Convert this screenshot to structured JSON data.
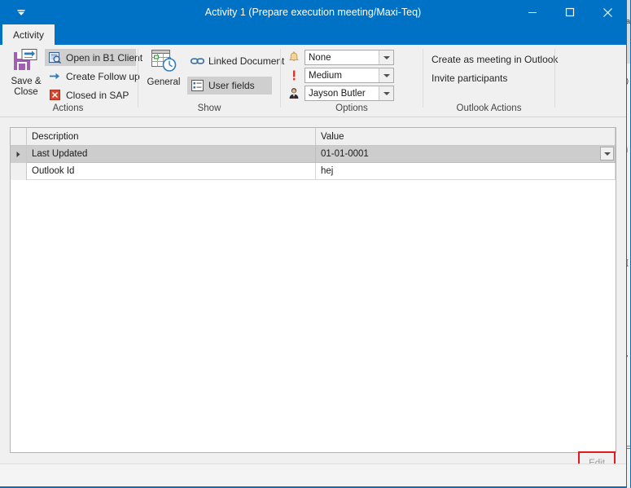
{
  "window": {
    "title": "Activity 1 (Prepare execution meeting/Maxi-Teq)",
    "qat_icon": "customize-quick-access-icon",
    "minimize_label": "—",
    "maximize_label": "☐",
    "close_label": "✕"
  },
  "tabs": [
    {
      "label": "Activity",
      "active": true
    }
  ],
  "ribbon": {
    "groups": [
      {
        "name": "actions",
        "label": "Actions",
        "big_button": {
          "label_line1": "Save &",
          "label_line2": "Close",
          "icon": "save-and-close-icon"
        },
        "buttons": [
          {
            "label": "Open in B1 Client",
            "icon": "open-in-b1-client-icon",
            "selected": true
          },
          {
            "label": "Create Follow up",
            "icon": "arrow-right-icon",
            "selected": false
          },
          {
            "label": "Closed in SAP",
            "icon": "close-red-icon",
            "selected": false
          }
        ]
      },
      {
        "name": "show",
        "label": "Show",
        "big_button": {
          "label_line1": "General",
          "label_line2": "",
          "icon": "calendar-clock-icon"
        },
        "buttons": [
          {
            "label": "Linked Document",
            "icon": "link-icon",
            "selected": false
          },
          {
            "label": "User fields",
            "icon": "user-fields-icon",
            "selected": true
          }
        ]
      },
      {
        "name": "options",
        "label": "Options",
        "combos": [
          {
            "icon": "bell-icon",
            "value": "None",
            "name": "reminder-combo"
          },
          {
            "icon": "priority-icon",
            "value": "Medium",
            "name": "priority-combo"
          },
          {
            "icon": "person-icon",
            "value": "Jayson Butler",
            "name": "assignee-combo"
          }
        ]
      },
      {
        "name": "outlook_actions",
        "label": "Outlook Actions",
        "text_buttons": [
          {
            "label": "Create as meeting in Outlook"
          },
          {
            "label": "Invite participants"
          }
        ]
      }
    ]
  },
  "grid": {
    "columns": [
      "Description",
      "Value"
    ],
    "rows": [
      {
        "description": "Last Updated",
        "value": "01-01-0001",
        "selected": true,
        "has_dropdown": true
      },
      {
        "description": "Outlook Id",
        "value": "hej",
        "selected": false,
        "has_dropdown": false
      }
    ]
  },
  "footer": {
    "edit_label": "Edit"
  },
  "colors": {
    "title_bar": "#0072c6",
    "ribbon_bg": "#f0f0f0",
    "selection": "#cdcdcd",
    "annotation": "#e01b1b",
    "status_accent": "#0a6fbb"
  }
}
